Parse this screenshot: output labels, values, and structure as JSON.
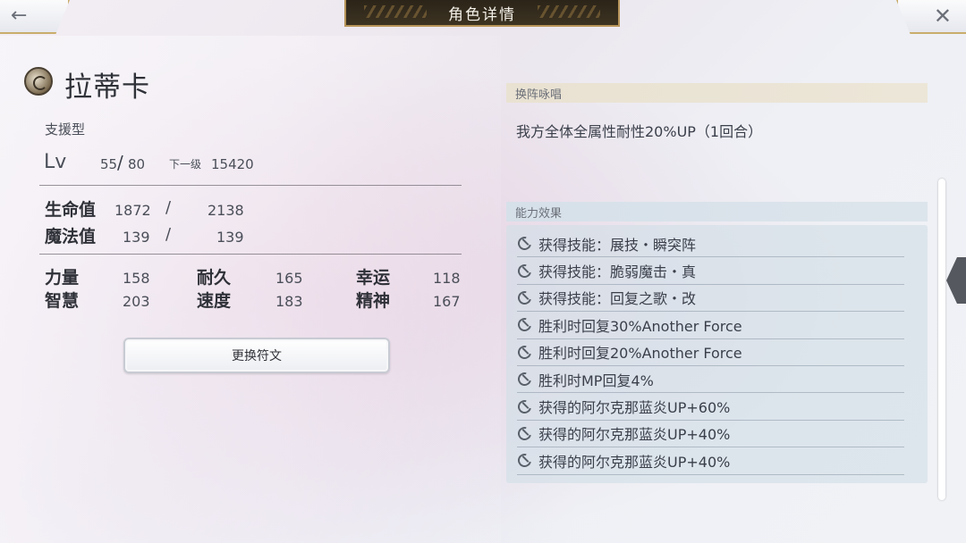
{
  "header": {
    "title": "角色详情",
    "back_icon": "back-arrow-icon",
    "close_icon": "close-icon"
  },
  "character": {
    "name": "拉蒂卡",
    "type": "支援型",
    "level": {
      "label": "Lv",
      "current": "55",
      "slash": "/",
      "max": "80",
      "next_label": "下一级",
      "next_exp": "15420"
    },
    "hp": {
      "label": "生命值",
      "current": "1872",
      "slash": "/",
      "max": "2138"
    },
    "mp": {
      "label": "魔法值",
      "current": "139",
      "slash": "/",
      "max": "139"
    },
    "stats": {
      "str": {
        "label": "力量",
        "value": "158"
      },
      "end": {
        "label": "耐久",
        "value": "165"
      },
      "luck": {
        "label": "幸运",
        "value": "118"
      },
      "int": {
        "label": "智慧",
        "value": "203"
      },
      "spd": {
        "label": "速度",
        "value": "183"
      },
      "spr": {
        "label": "精神",
        "value": "167"
      }
    },
    "rune_button": "更换符文"
  },
  "swap_chant": {
    "header": "换阵咏唱",
    "text": "我方全体全属性耐性20%UP（1回合）"
  },
  "abilities": {
    "header": "能力效果",
    "items": [
      "获得技能：展技・瞬突阵",
      "获得技能：脆弱魔击・真",
      "获得技能：回复之歌・改",
      "胜利时回复30%Another Force",
      "胜利时回复20%Another Force",
      "胜利时MP回复4%",
      "获得的阿尔克那蓝炎UP+60%",
      "获得的阿尔克那蓝炎UP+40%",
      "获得的阿尔克那蓝炎UP+40%"
    ]
  }
}
